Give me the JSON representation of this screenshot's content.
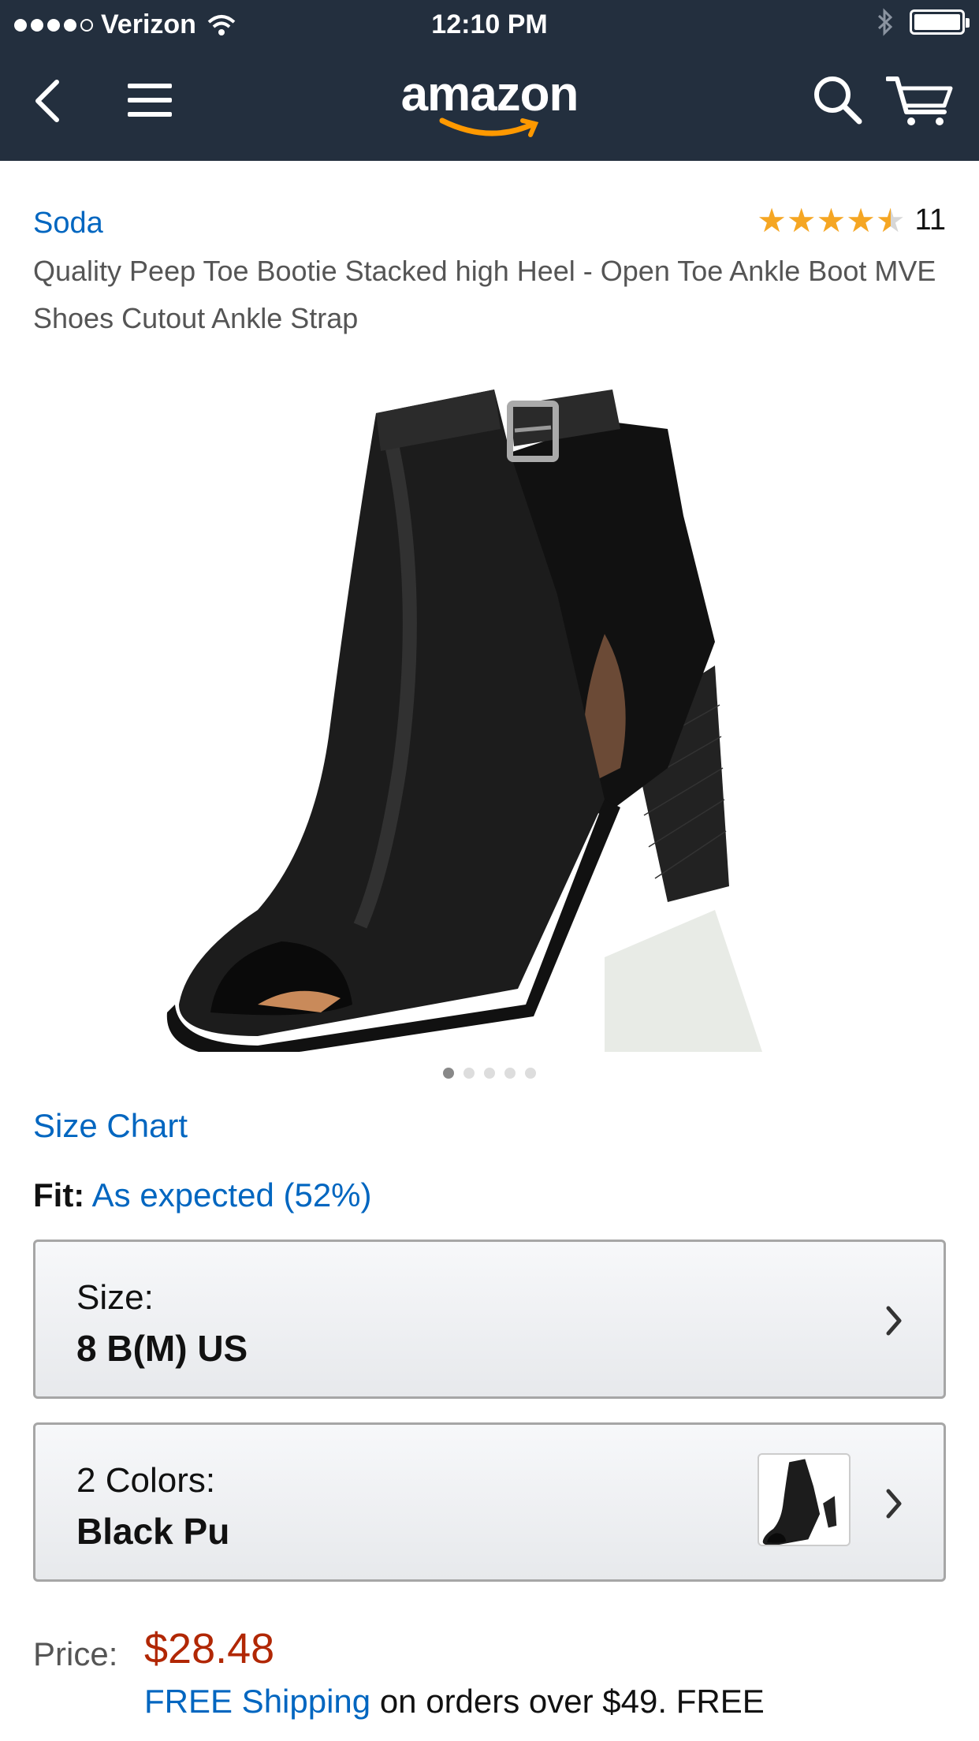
{
  "status_bar": {
    "carrier": "Verizon",
    "time": "12:10 PM",
    "signal_bars": 4,
    "signal_total": 5
  },
  "header": {
    "logo_text": "amazon",
    "icons": [
      "back-icon",
      "menu-icon",
      "search-icon",
      "cart-icon"
    ],
    "background_color": "#232f3e",
    "logo_smile_color": "#ff9900"
  },
  "product": {
    "brand": "Soda",
    "rating": 4.5,
    "review_count": "11",
    "title": "Quality Peep Toe Bootie Stacked high Heel - Open Toe Ankle Boot MVE Shoes Cutout Ankle Strap",
    "image_count": 5,
    "image_active_index": 0
  },
  "size_chart_link": "Size Chart",
  "fit": {
    "label": "Fit:",
    "value": "As expected (52%)"
  },
  "size_selector": {
    "label": "Size:",
    "value": "8 B(M) US"
  },
  "color_selector": {
    "label": "2 Colors:",
    "value": "Black Pu"
  },
  "price": {
    "label": "Price:",
    "value": "$28.48"
  },
  "shipping": {
    "link": "FREE Shipping",
    "text": " on orders over $49. FREE"
  },
  "colors": {
    "link": "#0066c0",
    "price": "#b12704",
    "star": "#f5a623"
  }
}
